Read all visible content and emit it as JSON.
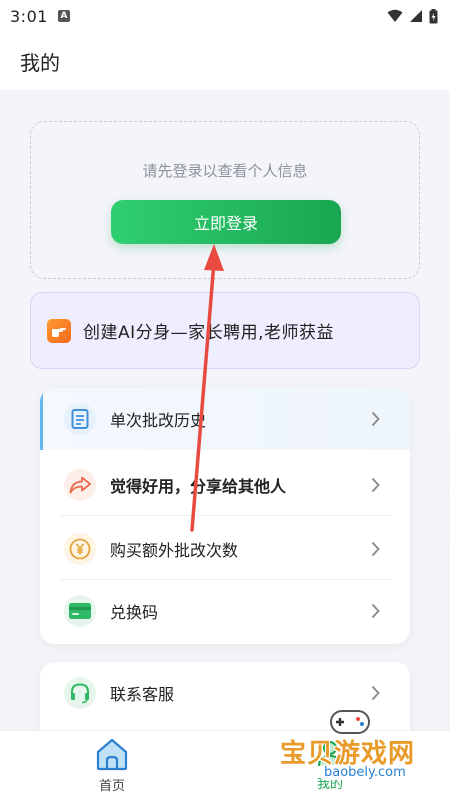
{
  "status_bar": {
    "time": "3:01",
    "app_badge": "A",
    "icons": [
      "wifi-icon",
      "signal-icon",
      "battery-icon"
    ]
  },
  "header": {
    "title": "我的"
  },
  "login": {
    "hint": "请先登录以查看个人信息",
    "button_label": "立即登录"
  },
  "promo": {
    "icon": "pointing-hand-icon",
    "text": "创建AI分身—家长聘用,老师获益"
  },
  "menu": {
    "items": [
      {
        "label": "单次批改历史",
        "icon": "document-icon",
        "bold": false
      },
      {
        "label": "觉得好用，分享给其他人",
        "icon": "share-icon",
        "bold": true
      },
      {
        "label": "购买额外批改次数",
        "icon": "yuan-coin-icon",
        "bold": false
      },
      {
        "label": "兑换码",
        "icon": "card-icon",
        "bold": false
      }
    ]
  },
  "menu2": {
    "items": [
      {
        "label": "联系客服",
        "icon": "headset-icon"
      }
    ]
  },
  "bottom_nav": {
    "home_label": "首页",
    "mine_label": "我的"
  },
  "watermark": {
    "title": "宝贝游戏网",
    "domain": "baobely.com"
  },
  "colors": {
    "accent_green": "#1aa651",
    "annotation_red": "#e84a3f",
    "promo_bg": "#efeefe"
  }
}
